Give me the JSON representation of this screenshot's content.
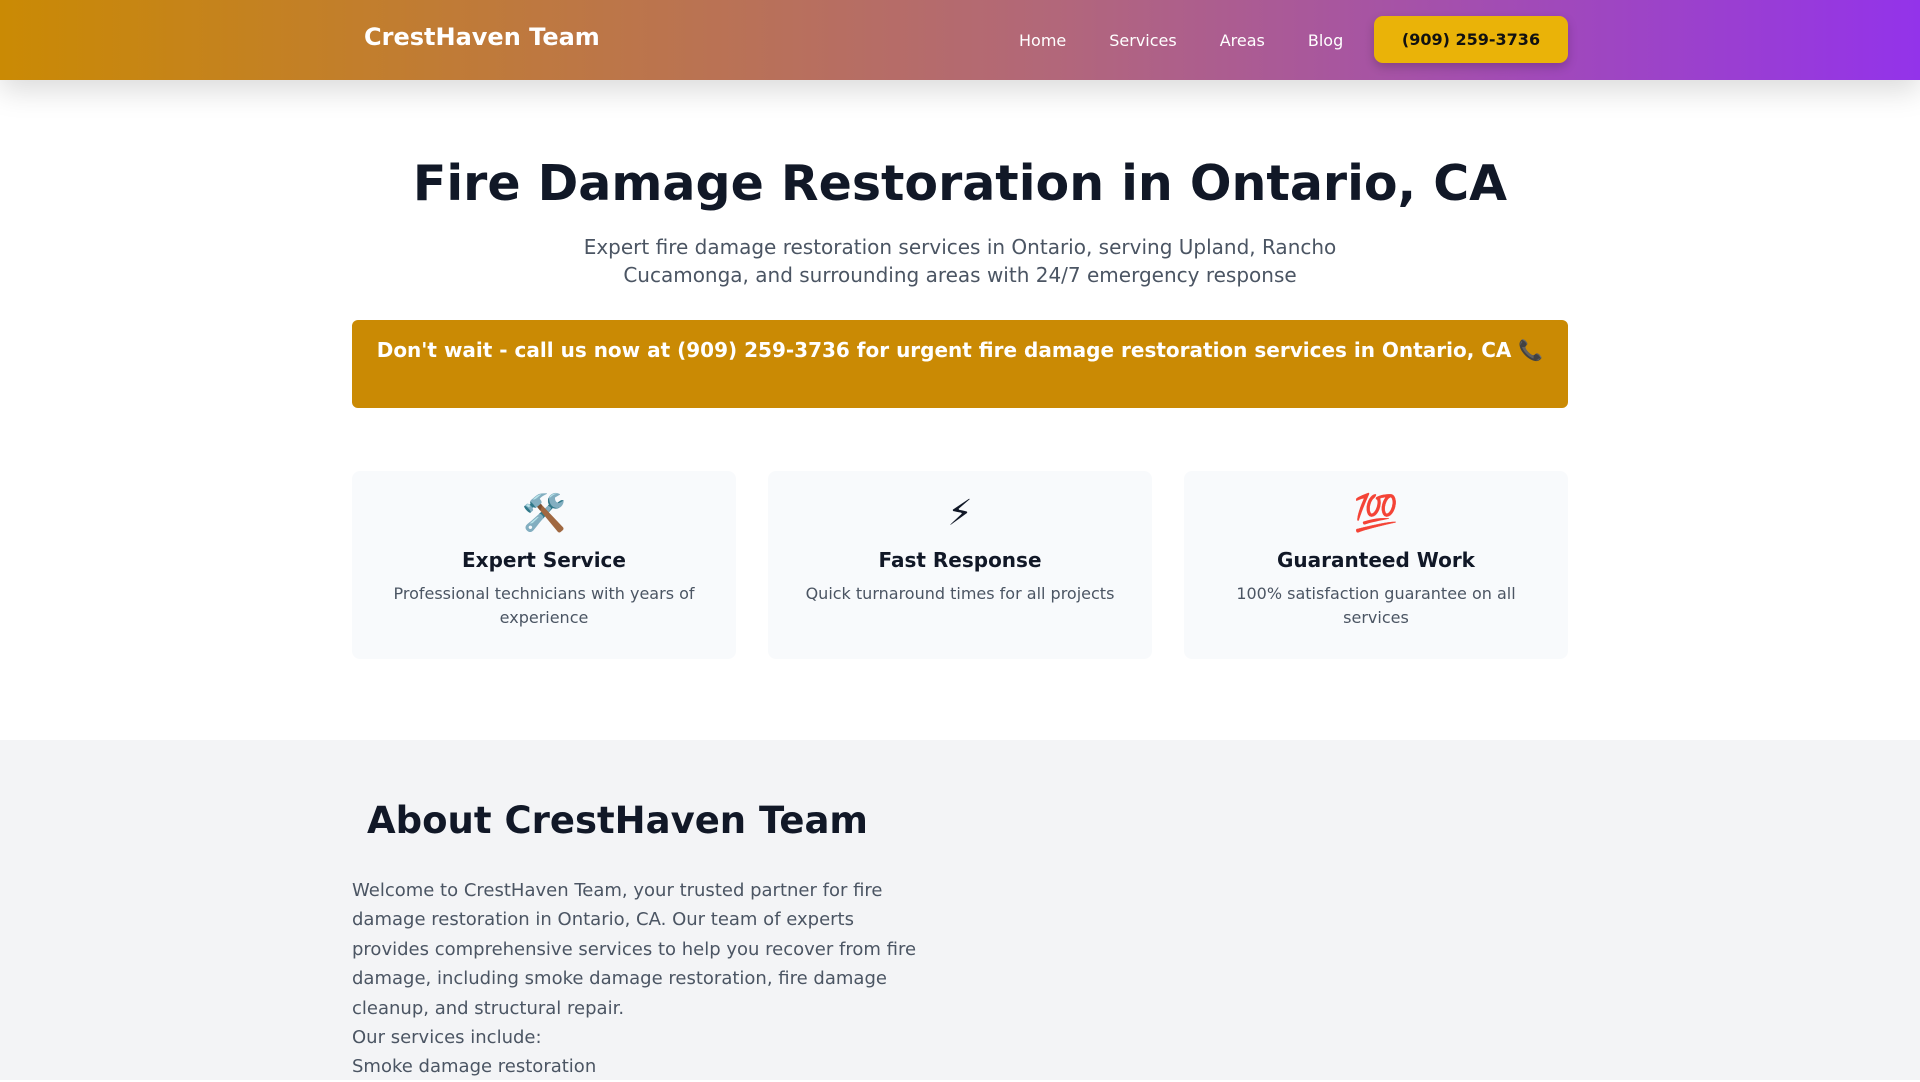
{
  "header": {
    "brand": "CrestHaven Team",
    "nav": [
      "Home",
      "Services",
      "Areas",
      "Blog"
    ],
    "phone_button": "(909) 259-3736"
  },
  "hero": {
    "title": "Fire Damage Restoration in Ontario, CA",
    "subtitle": "Expert fire damage restoration services in Ontario, serving Upland, Rancho Cucamonga, and surrounding areas with 24/7 emergency response",
    "banner": "Don't wait - call us now at (909) 259-3736 for urgent fire damage restoration services in Ontario, CA 📞"
  },
  "features": [
    {
      "icon": "🛠️",
      "title": "Expert Service",
      "text": "Professional technicians with years of experience"
    },
    {
      "icon": "⚡",
      "title": "Fast Response",
      "text": "Quick turnaround times for all projects"
    },
    {
      "icon": "💯",
      "title": "Guaranteed Work",
      "text": "100% satisfaction guarantee on all services"
    }
  ],
  "about": {
    "title": "About CrestHaven Team",
    "paragraph": "Welcome to CrestHaven Team, your trusted partner for fire damage restoration in Ontario, CA. Our team of experts provides comprehensive services to help you recover from fire damage, including smoke damage restoration, fire damage cleanup, and structural repair.",
    "services_intro": "Our services include:",
    "services": [
      "Smoke damage restoration"
    ]
  },
  "colors": {
    "accent": "#ca8a04",
    "button": "#eab308",
    "gradient_end": "#9333ea"
  }
}
